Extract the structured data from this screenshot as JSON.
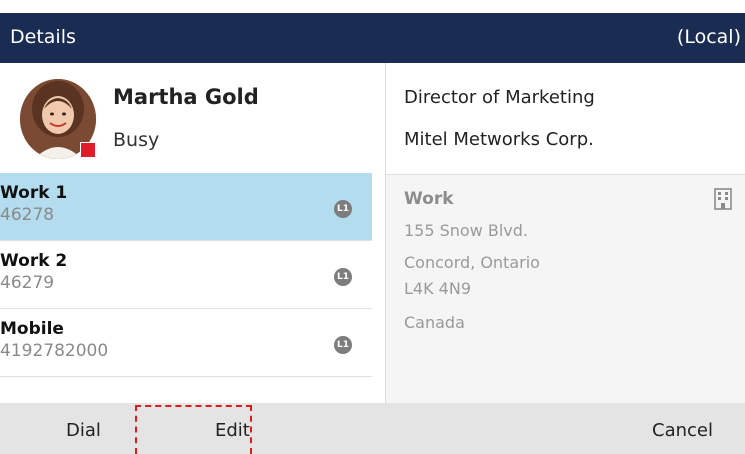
{
  "header": {
    "title": "Details",
    "right_label": "(Local)"
  },
  "contact": {
    "name": "Martha Gold",
    "status": "Busy",
    "status_color": "#e01b2a"
  },
  "entries": [
    {
      "label": "Work 1",
      "number": "46278",
      "line": "L1",
      "selected": true
    },
    {
      "label": "Work 2",
      "number": "46279",
      "line": "L1",
      "selected": false
    },
    {
      "label": "Mobile",
      "number": "4192782000",
      "line": "L1",
      "selected": false
    }
  ],
  "details": {
    "job_title": "Director of Marketing",
    "company": "Mitel Metworks Corp.",
    "address_label": "Work",
    "address_lines": [
      "155 Snow Blvd.",
      "Concord, Ontario",
      "L4K 4N9",
      "Canada"
    ],
    "address_icon": "building-icon"
  },
  "softkeys": {
    "dial": "Dial",
    "edit": "Edit",
    "cancel": "Cancel"
  },
  "colors": {
    "header_bg": "#1a2c52",
    "selected_bg": "#b3dcef",
    "softkey_bg": "#e4e4e4",
    "highlight": "#e01b1b"
  }
}
